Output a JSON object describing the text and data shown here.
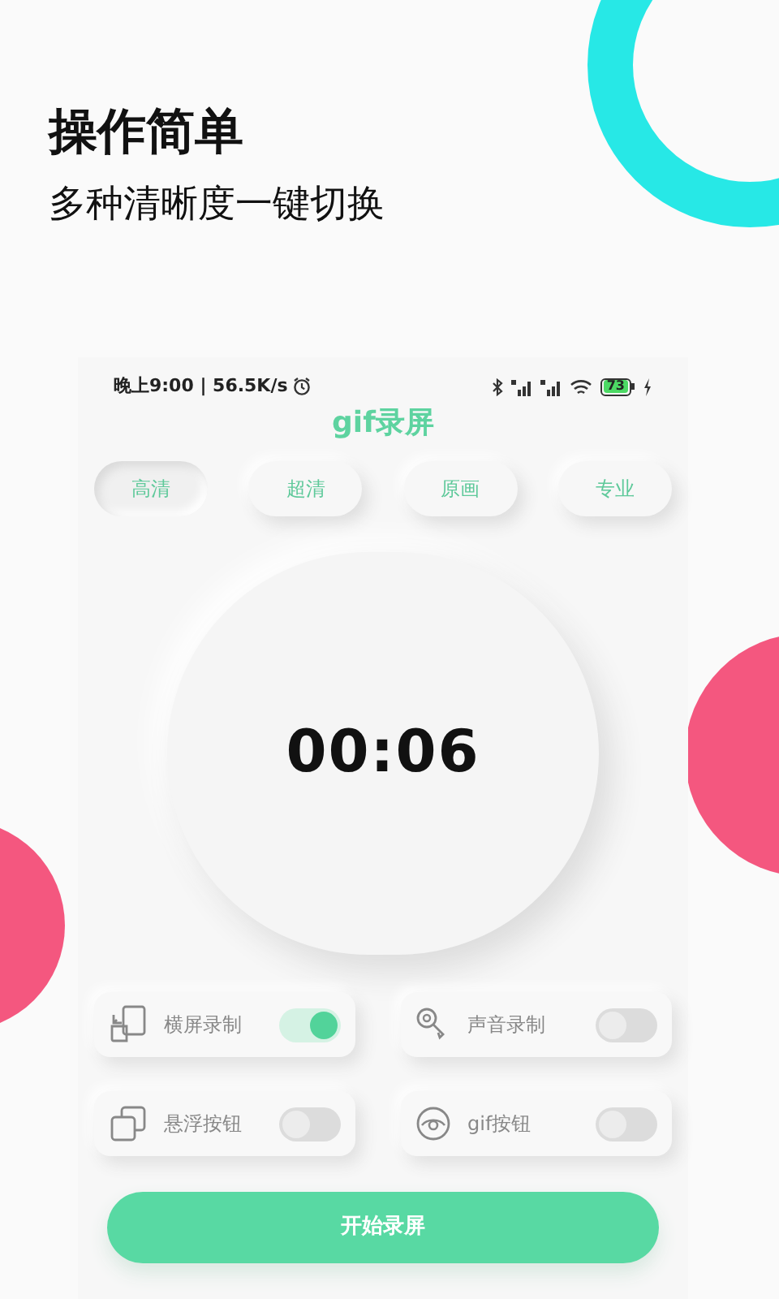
{
  "promo": {
    "headline": "操作简单",
    "subheadline": "多种清晰度一键切换"
  },
  "status_bar": {
    "time_speed": "晚上9:00 | 56.5K/s",
    "battery": "73"
  },
  "app_title": "gif录屏",
  "tabs": [
    {
      "label": "高清",
      "selected": true
    },
    {
      "label": "超清",
      "selected": false
    },
    {
      "label": "原画",
      "selected": false
    },
    {
      "label": "专业",
      "selected": false
    }
  ],
  "timer": "00:06",
  "options": [
    {
      "label": "横屏录制",
      "on": true
    },
    {
      "label": "声音录制",
      "on": false
    },
    {
      "label": "悬浮按钮",
      "on": false
    },
    {
      "label": "gif按钮",
      "on": false
    }
  ],
  "start_button": "开始录屏"
}
